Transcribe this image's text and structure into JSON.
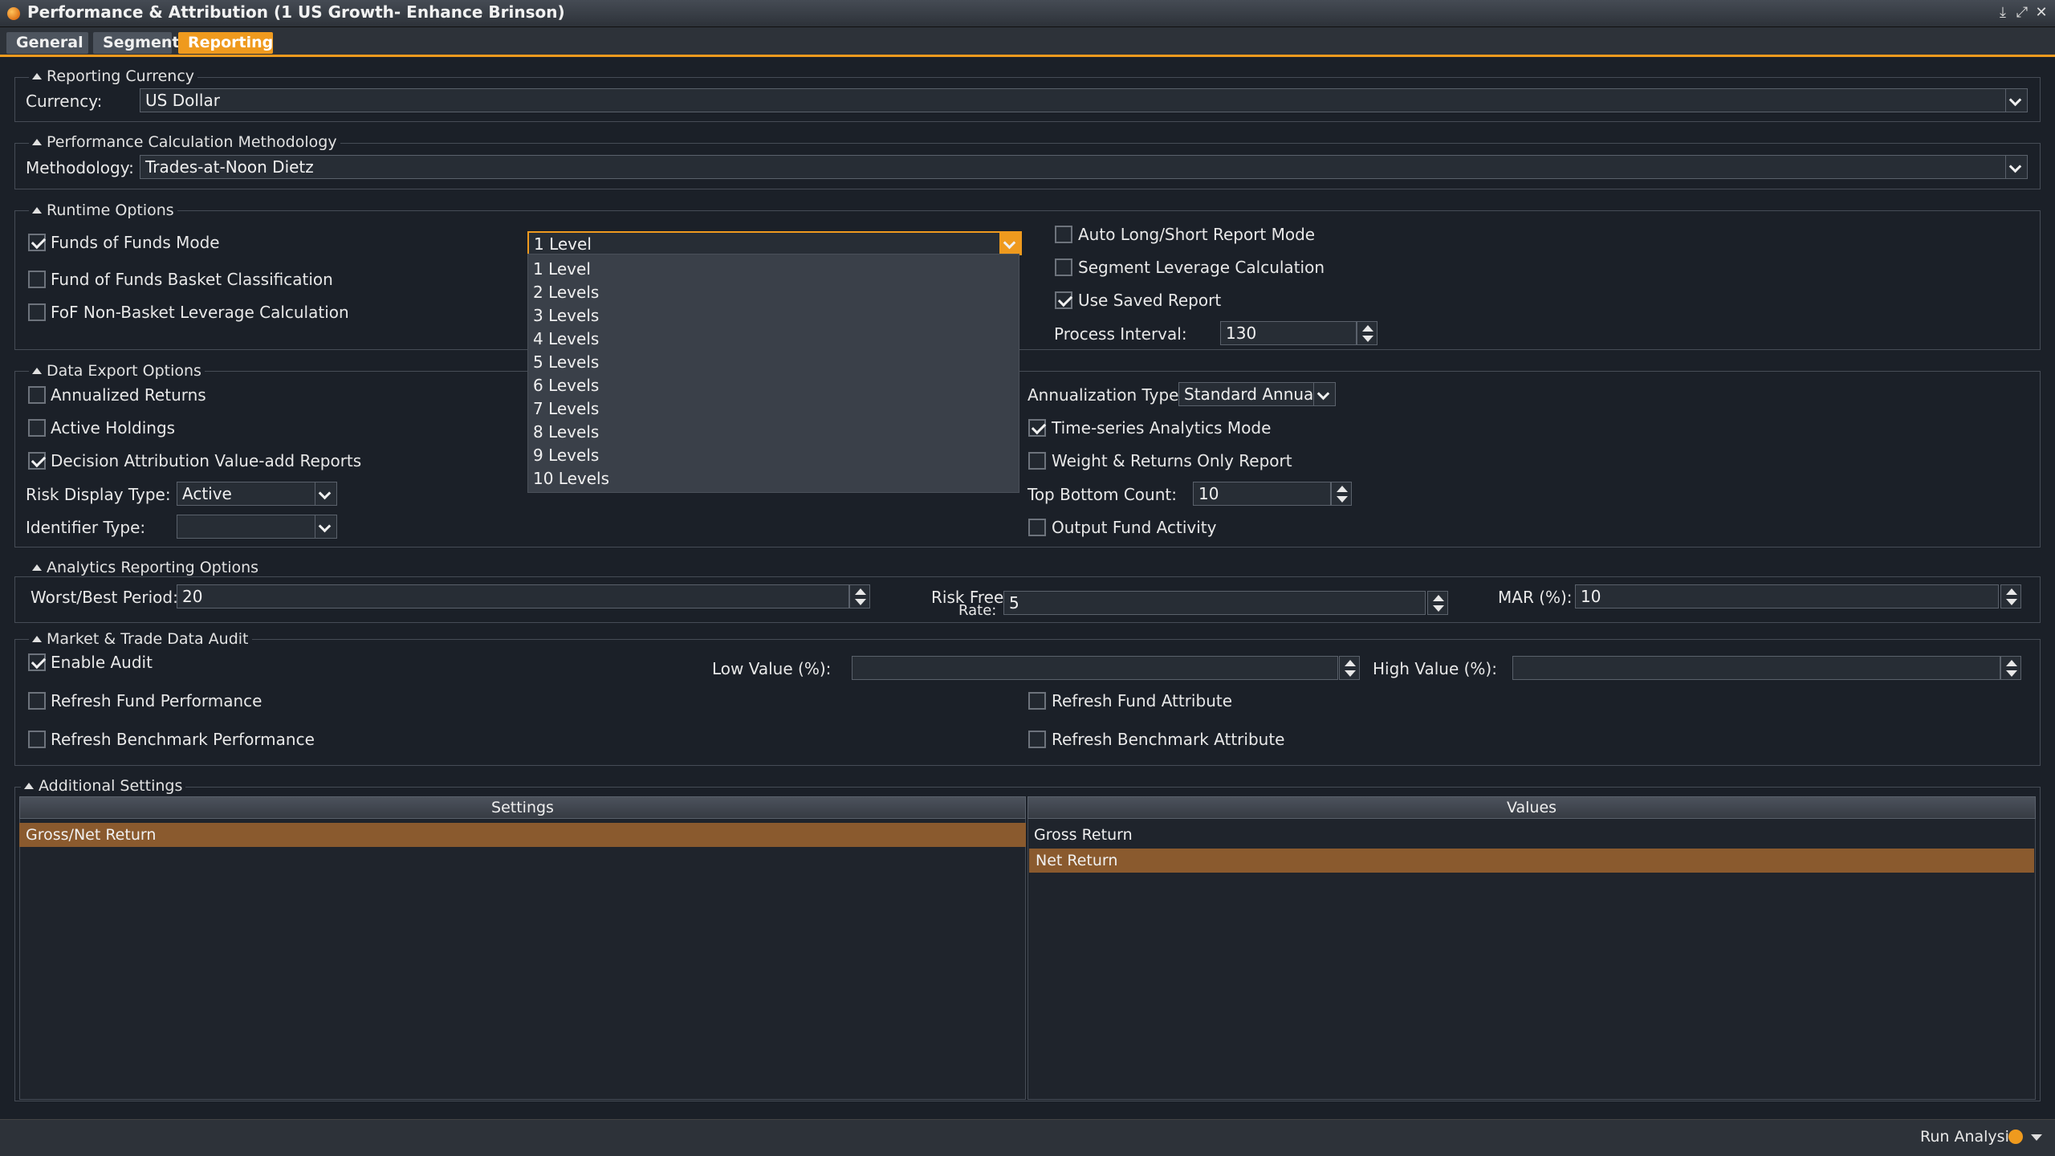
{
  "window": {
    "title": "Performance & Attribution (1 US Growth- Enhance Brinson)"
  },
  "tabs": [
    {
      "label": "General",
      "active": false
    },
    {
      "label": "Segment",
      "active": false
    },
    {
      "label": "Reporting",
      "active": true
    }
  ],
  "colors": {
    "accent": "#ef9a1e",
    "selection": "#8a5a2e",
    "background": "#1b2028"
  },
  "reporting_currency": {
    "legend": "Reporting Currency",
    "label": "Currency:",
    "value": "US Dollar"
  },
  "methodology": {
    "legend": "Performance Calculation Methodology",
    "label": "Methodology:",
    "value": "Trades-at-Noon Dietz"
  },
  "runtime": {
    "legend": "Runtime Options",
    "funds_of_funds_mode": {
      "label": "Funds of Funds Mode",
      "checked": true
    },
    "fof_basket_classification": {
      "label": "Fund of Funds Basket Classification",
      "checked": false
    },
    "fof_non_basket_leverage": {
      "label": "FoF Non-Basket Leverage Calculation",
      "checked": false
    },
    "levels_select": {
      "value": "1 Level",
      "open": true,
      "options": [
        "1 Level",
        "2 Levels",
        "3 Levels",
        "4 Levels",
        "5 Levels",
        "6 Levels",
        "7 Levels",
        "8 Levels",
        "9 Levels",
        "10 Levels"
      ]
    },
    "auto_long_short": {
      "label": "Auto Long/Short Report Mode",
      "checked": false
    },
    "segment_leverage": {
      "label": "Segment Leverage Calculation",
      "checked": false
    },
    "use_saved_report": {
      "label": "Use Saved Report",
      "checked": true
    },
    "process_interval": {
      "label": "Process Interval:",
      "value": "130"
    }
  },
  "data_export": {
    "legend": "Data Export Options",
    "annualized_returns": {
      "label": "Annualized Returns",
      "checked": false
    },
    "active_holdings": {
      "label": "Active Holdings",
      "checked": false
    },
    "decision_attribution": {
      "label": "Decision Attribution Value-add Reports",
      "checked": true
    },
    "risk_display_type": {
      "label": "Risk Display Type:",
      "value": "Active"
    },
    "identifier_type": {
      "label": "Identifier Type:",
      "value": ""
    },
    "annualization_type": {
      "label": "Annualization Type:",
      "value": "Standard Annualiz"
    },
    "time_series_mode": {
      "label": "Time-series Analytics Mode",
      "checked": true
    },
    "weight_returns_only": {
      "label": "Weight & Returns Only Report",
      "checked": false
    },
    "top_bottom_count": {
      "label": "Top Bottom Count:",
      "value": "10"
    },
    "output_fund_activity": {
      "label": "Output Fund Activity",
      "checked": false
    }
  },
  "analytics": {
    "legend": "Analytics Reporting Options",
    "worst_best_period": {
      "label": "Worst/Best Period:",
      "value": "20"
    },
    "risk_free_rate": {
      "label_line1": "Risk Free",
      "label_line2": "Rate:",
      "value": "5"
    },
    "mar": {
      "label": "MAR (%):",
      "value": "10"
    }
  },
  "audit": {
    "legend": "Market & Trade Data Audit",
    "enable_audit": {
      "label": "Enable Audit",
      "checked": true
    },
    "low_value": {
      "label": "Low Value (%):",
      "value": ""
    },
    "high_value": {
      "label": "High Value (%):",
      "value": ""
    },
    "refresh_fund_performance": {
      "label": "Refresh Fund Performance",
      "checked": false
    },
    "refresh_fund_attribute": {
      "label": "Refresh Fund Attribute",
      "checked": false
    },
    "refresh_benchmark_performance": {
      "label": "Refresh Benchmark Performance",
      "checked": false
    },
    "refresh_benchmark_attribute": {
      "label": "Refresh Benchmark Attribute",
      "checked": false
    }
  },
  "additional": {
    "legend": "Additional Settings",
    "settings_header": "Settings",
    "values_header": "Values",
    "settings_rows": [
      "Gross/Net Return"
    ],
    "values_rows": [
      "Gross Return",
      "Net Return"
    ]
  },
  "footer": {
    "run_label": "Run Analysis"
  }
}
